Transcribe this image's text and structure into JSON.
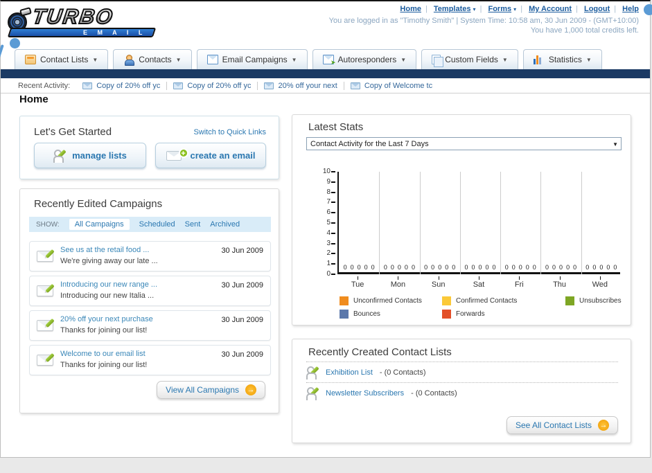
{
  "brand": {
    "name_top": "TURBO",
    "name_bottom": "E M A I L"
  },
  "header": {
    "links": [
      {
        "label": "Home",
        "dropdown": false
      },
      {
        "label": "Templates",
        "dropdown": true
      },
      {
        "label": "Forms",
        "dropdown": true
      },
      {
        "label": "My Account",
        "dropdown": false
      },
      {
        "label": "Logout",
        "dropdown": false
      },
      {
        "label": "Help",
        "dropdown": false
      }
    ],
    "status_line1": "You are logged in as \"Timothy Smith\" | System Time: 10:58 am, 30 Jun 2009 - (GMT+10:00)",
    "status_line2": "You have 1,000 total credits left."
  },
  "nav_tabs": [
    {
      "label": "Contact Lists"
    },
    {
      "label": "Contacts"
    },
    {
      "label": "Email Campaigns"
    },
    {
      "label": "Autoresponders"
    },
    {
      "label": "Custom Fields"
    },
    {
      "label": "Statistics"
    }
  ],
  "recent_activity": {
    "label": "Recent Activity:",
    "items": [
      {
        "text": "Copy of 20% off yc"
      },
      {
        "text": "Copy of 20% off yc"
      },
      {
        "text": "20% off your next"
      },
      {
        "text": "Copy of Welcome tc"
      }
    ]
  },
  "page": {
    "heading": "Home"
  },
  "get_started": {
    "title": "Let's Get Started",
    "switch_link": "Switch to Quick Links",
    "manage_lists_label": "manage lists",
    "create_email_label": "create an email"
  },
  "campaigns": {
    "title": "Recently Edited Campaigns",
    "show_label": "SHOW:",
    "filters": [
      "All Campaigns",
      "Scheduled",
      "Sent",
      "Archived"
    ],
    "active_filter": "All Campaigns",
    "items": [
      {
        "title": "See us at the retail food ...",
        "subtitle": "We're giving away our late ...",
        "date": "30 Jun 2009"
      },
      {
        "title": "Introducing our new range ...",
        "subtitle": "Introducing our new Italia ...",
        "date": "30 Jun 2009"
      },
      {
        "title": "20% off your next purchase",
        "subtitle": "Thanks for joining our list!",
        "date": "30 Jun 2009"
      },
      {
        "title": "Welcome to our email list",
        "subtitle": "Thanks for joining our list!",
        "date": "30 Jun 2009"
      }
    ],
    "view_all_label": "View All Campaigns"
  },
  "stats": {
    "title": "Latest Stats",
    "dropdown_value": "Contact Activity for the Last 7 Days"
  },
  "chart_data": {
    "type": "bar",
    "title": "Contact Activity for the Last 7 Days",
    "categories": [
      "Tue",
      "Mon",
      "Sun",
      "Sat",
      "Fri",
      "Thu",
      "Wed"
    ],
    "series": [
      {
        "name": "Unconfirmed Contacts",
        "color": "#f08c1e",
        "values": [
          0,
          0,
          0,
          0,
          0,
          0,
          0
        ]
      },
      {
        "name": "Confirmed Contacts",
        "color": "#fbc938",
        "values": [
          0,
          0,
          0,
          0,
          0,
          0,
          0
        ]
      },
      {
        "name": "Unsubscribes",
        "color": "#7ea624",
        "values": [
          0,
          0,
          0,
          0,
          0,
          0,
          0
        ]
      },
      {
        "name": "Bounces",
        "color": "#5b78ab",
        "values": [
          0,
          0,
          0,
          0,
          0,
          0,
          0
        ]
      },
      {
        "name": "Forwards",
        "color": "#e35029",
        "values": [
          0,
          0,
          0,
          0,
          0,
          0,
          0
        ]
      }
    ],
    "ylim": [
      0,
      10
    ],
    "ytick_step": 1,
    "grid": "vertical",
    "legend_position": "bottom",
    "value_labels_shown": true
  },
  "contact_lists": {
    "title": "Recently Created Contact Lists",
    "items": [
      {
        "name": "Exhibition List",
        "detail": "- (0 Contacts)"
      },
      {
        "name": "Newsletter Subscribers",
        "detail": "- (0 Contacts)"
      }
    ],
    "see_all_label": "See All Contact Lists"
  },
  "colors": {
    "navy_bar": "#1b3a64",
    "link_blue": "#2a77b0",
    "show_bar_bg": "#d9ecf8",
    "annotation_blue": "#5b9bd5",
    "orange_button": "#ef9b00"
  }
}
